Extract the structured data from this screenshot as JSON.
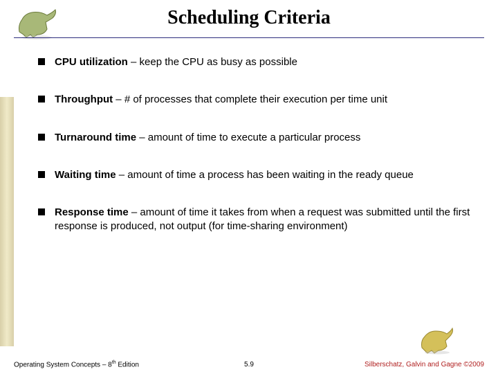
{
  "header": {
    "title": "Scheduling Criteria"
  },
  "bullets": [
    {
      "term": "CPU utilization",
      "desc": " – keep the CPU as busy as possible"
    },
    {
      "term": "Throughput",
      "desc": " – # of processes that complete their execution per time unit"
    },
    {
      "term": "Turnaround time",
      "desc": " – amount of time to execute a particular process"
    },
    {
      "term": "Waiting time",
      "desc": " – amount of time a process has been waiting in the ready queue"
    },
    {
      "term": "Response time",
      "desc": " – amount of time it takes from when a request was submitted until the first response is produced, not output  (for time-sharing environment)"
    }
  ],
  "footer": {
    "left_prefix": "Operating System Concepts – 8",
    "left_sup": "th",
    "left_suffix": " Edition",
    "center": "5.9",
    "right": "Silberschatz, Galvin and Gagne ©2009"
  }
}
